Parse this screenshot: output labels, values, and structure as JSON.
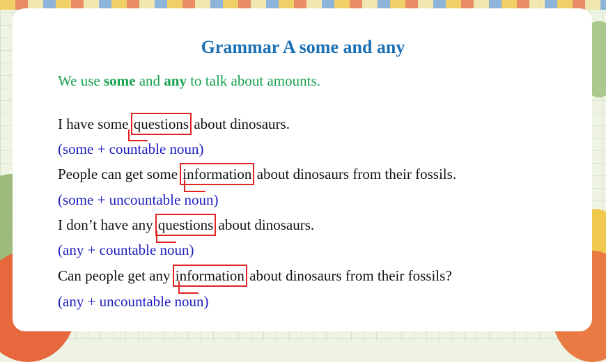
{
  "title": "Grammar A some and any",
  "intro": {
    "prefix": "We use ",
    "some": "some",
    "middle": " and ",
    "any": "any",
    "suffix": " to talk about amounts."
  },
  "examples": [
    {
      "before": "I have some ",
      "keyword": "questions",
      "after": " about dinosaurs.",
      "note": "(some + countable noun)"
    },
    {
      "before": "People can get some ",
      "keyword": "information",
      "after": "  about dinosaurs from their fossils.",
      "note": "(some + uncountable noun)"
    },
    {
      "before": "I don’t have any ",
      "keyword": "questions",
      "after": " about dinosaurs.",
      "note": "(any + countable noun)"
    },
    {
      "before": "Can people get any ",
      "keyword": "information",
      "after": " about dinosaurs from their fossils?",
      "note": "(any + uncountable noun)"
    }
  ],
  "colors": {
    "title": "#1c70b4",
    "intro": "#17a04e",
    "note": "#1d1dbf",
    "highlight_box": "#e02424"
  }
}
